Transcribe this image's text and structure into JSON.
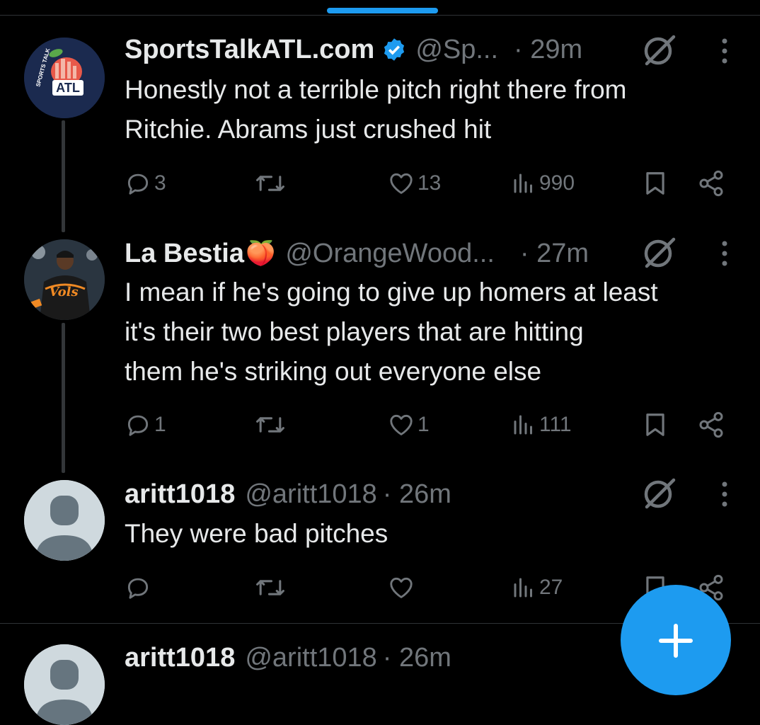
{
  "tweets": [
    {
      "name": "SportsTalkATL.com",
      "verified": true,
      "handle": "@Sp...",
      "time": "· 29m",
      "text_lines": [
        "Honestly not a terrible pitch right there from",
        "Ritchie. Abrams just crushed hit"
      ],
      "replies": "3",
      "reposts": "",
      "likes": "13",
      "views": "990",
      "avatar_text": "ATL",
      "avatar_subtext": "SPORTS TALK"
    },
    {
      "name": "La Bestia",
      "name_emoji": "🍑",
      "handle": "@OrangeWood...",
      "time": "· 27m",
      "text_lines": [
        "I mean if he's going to give up homers at least",
        "it's their two best players that are hitting",
        "them he's striking out everyone else"
      ],
      "replies": "1",
      "reposts": "",
      "likes": "1",
      "views": "111",
      "avatar_text": "Vols"
    },
    {
      "name": "aritt1018",
      "handle": "@aritt1018",
      "time": "· 26m",
      "text_lines": [
        "They were bad pitches"
      ],
      "replies": "",
      "reposts": "",
      "likes": "",
      "views": "27"
    },
    {
      "name": "aritt1018",
      "handle": "@aritt1018",
      "time": "· 26m"
    }
  ],
  "icons": {
    "reply": "reply-icon",
    "repost": "repost-icon",
    "like": "heart-icon",
    "views": "views-icon",
    "bookmark": "bookmark-icon",
    "share": "share-icon",
    "grok": "grok-icon",
    "more": "more-icon",
    "compose": "plus-icon"
  },
  "colors": {
    "background": "#000000",
    "accent": "#1d9bf0",
    "text": "#e7e9ea",
    "muted": "#71767b",
    "divider": "#2f3336"
  }
}
